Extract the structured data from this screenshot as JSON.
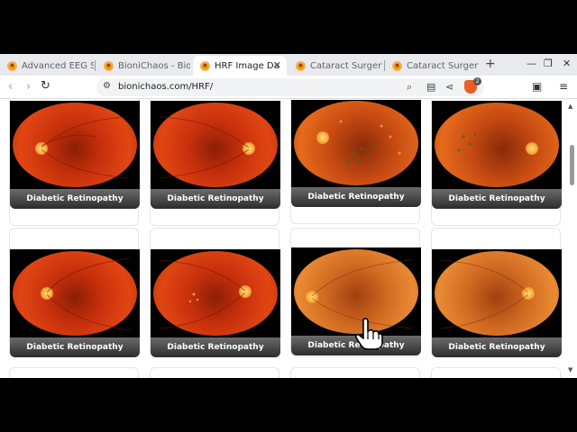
{
  "tabs": [
    {
      "label": "Advanced EEG Sig",
      "active": false
    },
    {
      "label": "BioniChaos - Bion",
      "active": false
    },
    {
      "label": "HRF Image Da",
      "active": true
    },
    {
      "label": "Cataract Surgery",
      "active": false
    },
    {
      "label": "Cataract Surgery",
      "active": false
    }
  ],
  "address_bar": {
    "url": "bionichaos.com/HRF/"
  },
  "shields_count": "2",
  "cards": [
    {
      "caption": "Diabetic Retinopathy"
    },
    {
      "caption": "Diabetic Retinopathy"
    },
    {
      "caption": "Diabetic Retinopathy"
    },
    {
      "caption": "Diabetic Retinopathy"
    },
    {
      "caption": "Diabetic Retinopathy"
    },
    {
      "caption": "Diabetic Retinopathy"
    },
    {
      "caption": "Diabetic Retinopathy"
    },
    {
      "caption": "Diabetic Retinopathy"
    }
  ],
  "colors": {
    "favicon": "#e98e1a",
    "caption_bar": "#3a3a3a",
    "fundus": "#d8400f"
  }
}
